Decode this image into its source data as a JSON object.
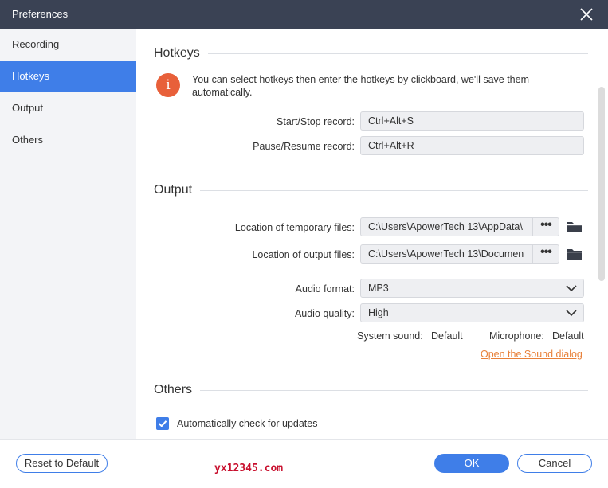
{
  "window": {
    "title": "Preferences"
  },
  "sidebar": {
    "items": [
      {
        "label": "Recording"
      },
      {
        "label": "Hotkeys"
      },
      {
        "label": "Output"
      },
      {
        "label": "Others"
      }
    ],
    "active": "Hotkeys"
  },
  "hotkeys": {
    "title": "Hotkeys",
    "info_icon": "i",
    "info_text": "You can select hotkeys then enter the hotkeys by clickboard, we'll save them automatically.",
    "start_stop_label": "Start/Stop record:",
    "start_stop_value": "Ctrl+Alt+S",
    "pause_resume_label": "Pause/Resume record:",
    "pause_resume_value": "Ctrl+Alt+R"
  },
  "output": {
    "title": "Output",
    "temp_label": "Location of temporary files:",
    "temp_value": "C:\\Users\\ApowerTech 13\\AppData\\",
    "output_label": "Location of output files:",
    "output_value": "C:\\Users\\ApowerTech 13\\Documen",
    "browse_label": "•••",
    "audio_format_label": "Audio format:",
    "audio_format_value": "MP3",
    "audio_quality_label": "Audio quality:",
    "audio_quality_value": "High",
    "system_sound_label": "System sound:",
    "system_sound_value": "Default",
    "microphone_label": "Microphone:",
    "microphone_value": "Default",
    "sound_dialog_link": "Open the Sound dialog"
  },
  "others": {
    "title": "Others",
    "auto_update_label": "Automatically check for updates",
    "auto_update_checked": true
  },
  "footer": {
    "reset_label": "Reset to Default",
    "ok_label": "OK",
    "cancel_label": "Cancel",
    "watermark": "yx12345.com"
  },
  "colors": {
    "titlebar": "#3a4254",
    "accent": "#3f7ee8",
    "info_icon": "#e8603a",
    "link": "#e8813a",
    "watermark": "#c8102e"
  },
  "icons": {
    "close": "close-icon",
    "info": "info-icon",
    "folder": "folder-icon",
    "chevron": "chevron-down-icon",
    "check": "checkmark-icon"
  }
}
